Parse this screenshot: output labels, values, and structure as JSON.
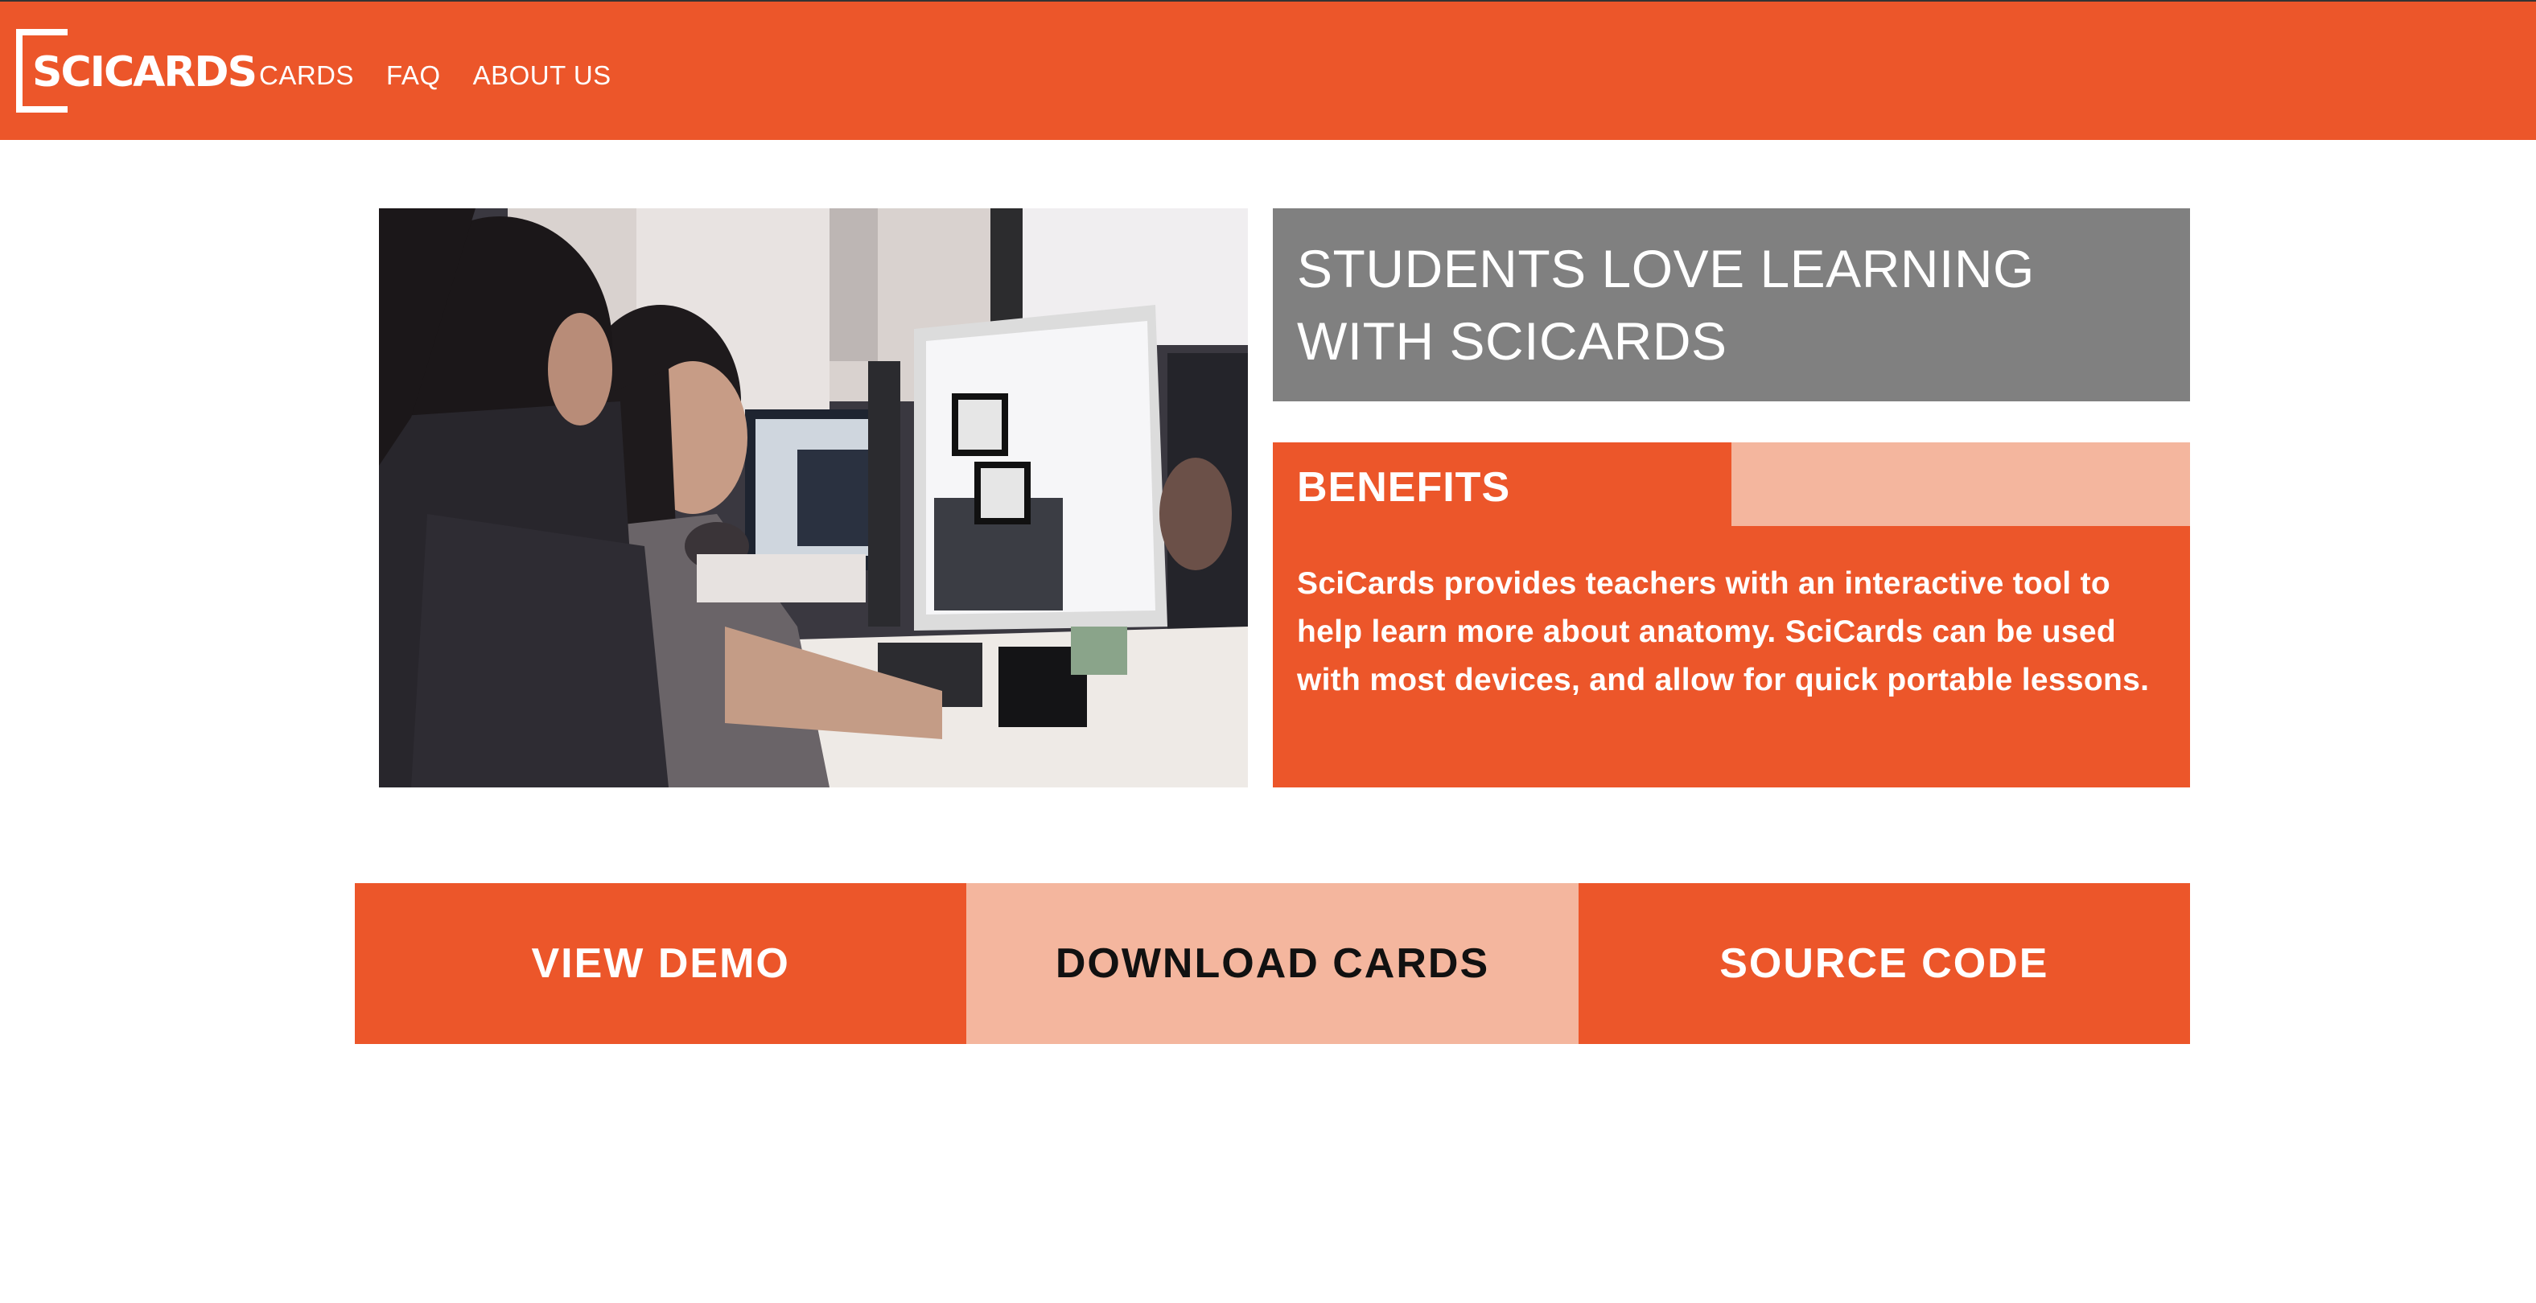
{
  "brand": {
    "logo_text": "SCICARDS",
    "primary_color": "#EC562A",
    "accent_color": "#F4B69E",
    "title_bg_color": "#808080"
  },
  "nav": {
    "items": [
      {
        "label": "CARDS"
      },
      {
        "label": "FAQ"
      },
      {
        "label": "ABOUT US"
      }
    ]
  },
  "hero": {
    "photo_icon": "students-at-computers-photo",
    "title": "STUDENTS LOVE LEARNING WITH SCICARDS"
  },
  "benefits": {
    "heading": "BENEFITS",
    "body": "SciCards provides teachers with an interactive tool to help learn more about anatomy. SciCards can be used with most devices, and allow for quick portable lessons."
  },
  "actions": [
    {
      "label": "VIEW DEMO"
    },
    {
      "label": "DOWNLOAD CARDS"
    },
    {
      "label": "SOURCE CODE"
    }
  ]
}
